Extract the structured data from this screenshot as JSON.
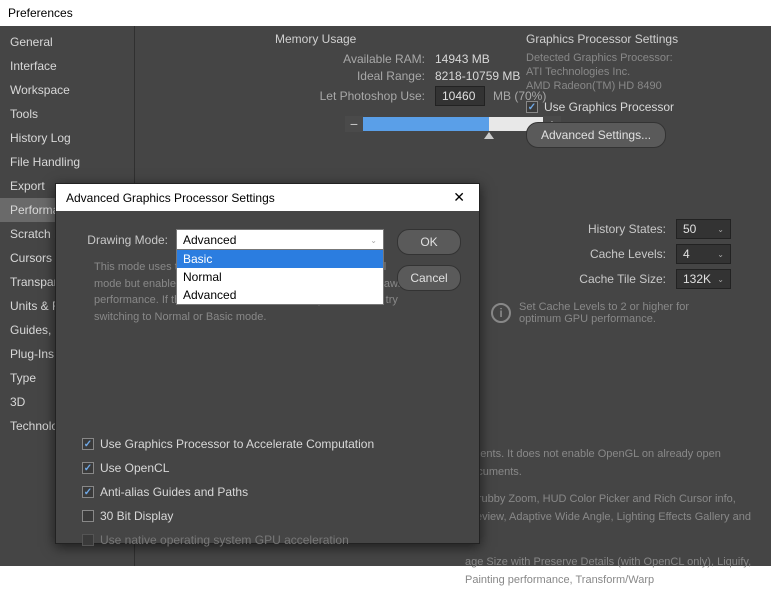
{
  "window_title": "Preferences",
  "sidebar": {
    "items": [
      "General",
      "Interface",
      "Workspace",
      "Tools",
      "History Log",
      "File Handling",
      "Export",
      "Performance",
      "Scratch Disks",
      "Cursors",
      "Transparency & Gamut",
      "Units & Rulers",
      "Guides, Grid & Slices",
      "Plug-Ins",
      "Type",
      "3D",
      "Technology Previews"
    ],
    "active_index": 7
  },
  "memory": {
    "section": "Memory Usage",
    "available_label": "Available RAM:",
    "available_value": "14943 MB",
    "ideal_label": "Ideal Range:",
    "ideal_value": "8218-10759 MB",
    "use_label": "Let Photoshop Use:",
    "use_value": "10460",
    "use_suffix": "MB (70%)",
    "minus": "−",
    "plus": "+"
  },
  "gpu": {
    "section": "Graphics Processor Settings",
    "detected_label": "Detected Graphics Processor:",
    "vendor": "ATI Technologies Inc.",
    "card": "AMD Radeon(TM) HD 8490",
    "use_gpu_label": "Use Graphics Processor",
    "adv_btn": "Advanced Settings..."
  },
  "options": {
    "history_label": "History States:",
    "history_value": "50",
    "cache_levels_label": "Cache Levels:",
    "cache_levels_value": "4",
    "cache_tile_label": "Cache Tile Size:",
    "cache_tile_value": "132K",
    "hint": "Set Cache Levels to 2 or higher for optimum GPU performance.",
    "info_glyph": "i"
  },
  "notes": {
    "n1": "ements. It does not enable OpenGL on already open documents.",
    "n2": "Scrubby Zoom, HUD Color Picker and Rich Cursor info,\nPreview, Adaptive Wide Angle, Lighting Effects Gallery and all",
    "n3": "age Size with Preserve Details (with OpenCL only), Liquify,\nPainting performance, Transform/Warp"
  },
  "modal": {
    "title": "Advanced Graphics Processor Settings",
    "close": "✕",
    "mode_label": "Drawing Mode:",
    "mode_value": "Advanced",
    "mode_options": [
      "Basic",
      "Normal",
      "Advanced"
    ],
    "mode_hl_index": 0,
    "desc": "This mode uses the same amount of memory as the Normal mode but enables more advanced techniques to improve drawing performance. If this mode seems to decrease performance, try switching to Normal or Basic mode.",
    "ok": "OK",
    "cancel": "Cancel",
    "checks": {
      "accel": "Use Graphics Processor to Accelerate Computation",
      "opencl": "Use OpenCL",
      "aa": "Anti-alias Guides and Paths",
      "bit30": "30 Bit Display",
      "native": "Use native operating system GPU acceleration"
    }
  }
}
